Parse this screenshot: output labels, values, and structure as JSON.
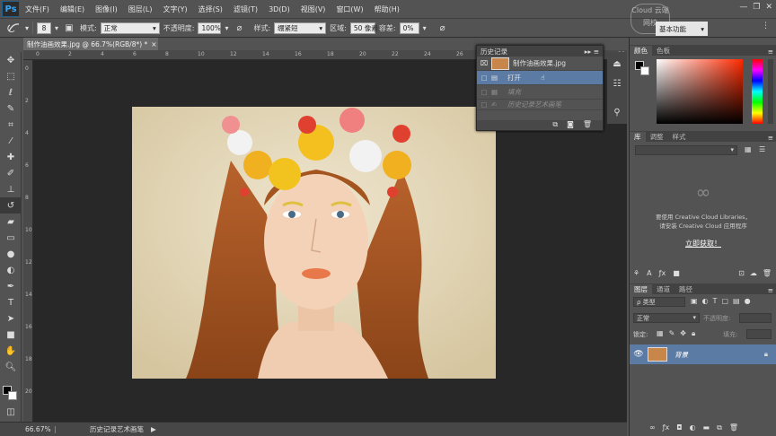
{
  "menubar": {
    "logo": "Ps",
    "items": [
      "文件(F)",
      "编辑(E)",
      "图像(I)",
      "图层(L)",
      "文字(Y)",
      "选择(S)",
      "滤镜(T)",
      "3D(D)",
      "视图(V)",
      "窗口(W)",
      "帮助(H)"
    ]
  },
  "options": {
    "brush_size": "8",
    "mode_label": "模式:",
    "mode_value": "正常",
    "opacity_label": "不透明度:",
    "opacity_value": "100%",
    "style_label": "样式:",
    "style_value": "绷紧短",
    "area_label": "区域:",
    "area_value": "50 像素",
    "tolerance_label": "容差:",
    "tolerance_value": "0%",
    "workspace": "基本功能"
  },
  "watermark": "Cloud 云端网校",
  "document": {
    "tab_title": "制作油画效果.jpg @ 66.7%(RGB/8*) *",
    "close": "×"
  },
  "ruler_top": [
    "0",
    "2",
    "4",
    "6",
    "8",
    "10",
    "12",
    "14",
    "16",
    "18",
    "20",
    "22",
    "24",
    "26",
    "28",
    "30",
    "32",
    "34",
    "36"
  ],
  "ruler_left": [
    "0",
    "2",
    "4",
    "6",
    "8",
    "10",
    "12",
    "14",
    "16",
    "18",
    "20"
  ],
  "status": {
    "zoom": "66.67%",
    "info": "历史记录艺术画笔"
  },
  "history": {
    "title": "历史记录",
    "snapshot": "制作油画效果.jpg",
    "steps": [
      "打开",
      "填充",
      "历史记录艺术画笔"
    ],
    "selected_index": 0
  },
  "color_panel": {
    "tabs": [
      "颜色",
      "色板"
    ]
  },
  "libraries": {
    "tabs": [
      "库",
      "调整",
      "样式"
    ],
    "message_line1": "要使用 Creative Cloud Libraries，",
    "message_line2": "请安装 Creative Cloud 应用程序",
    "link": "立即获取！"
  },
  "layers": {
    "tabs": [
      "图层",
      "通道",
      "路径"
    ],
    "filter": "ρ 类型",
    "blend_mode": "正常",
    "opacity_label": "不透明度:",
    "lock_label": "锁定:",
    "fill_label": "填充:",
    "layer_name": "背景"
  },
  "colors": {
    "accent_blue": "#5b7ba5",
    "canvas_bg": "#282828",
    "panel_bg": "#535353"
  }
}
